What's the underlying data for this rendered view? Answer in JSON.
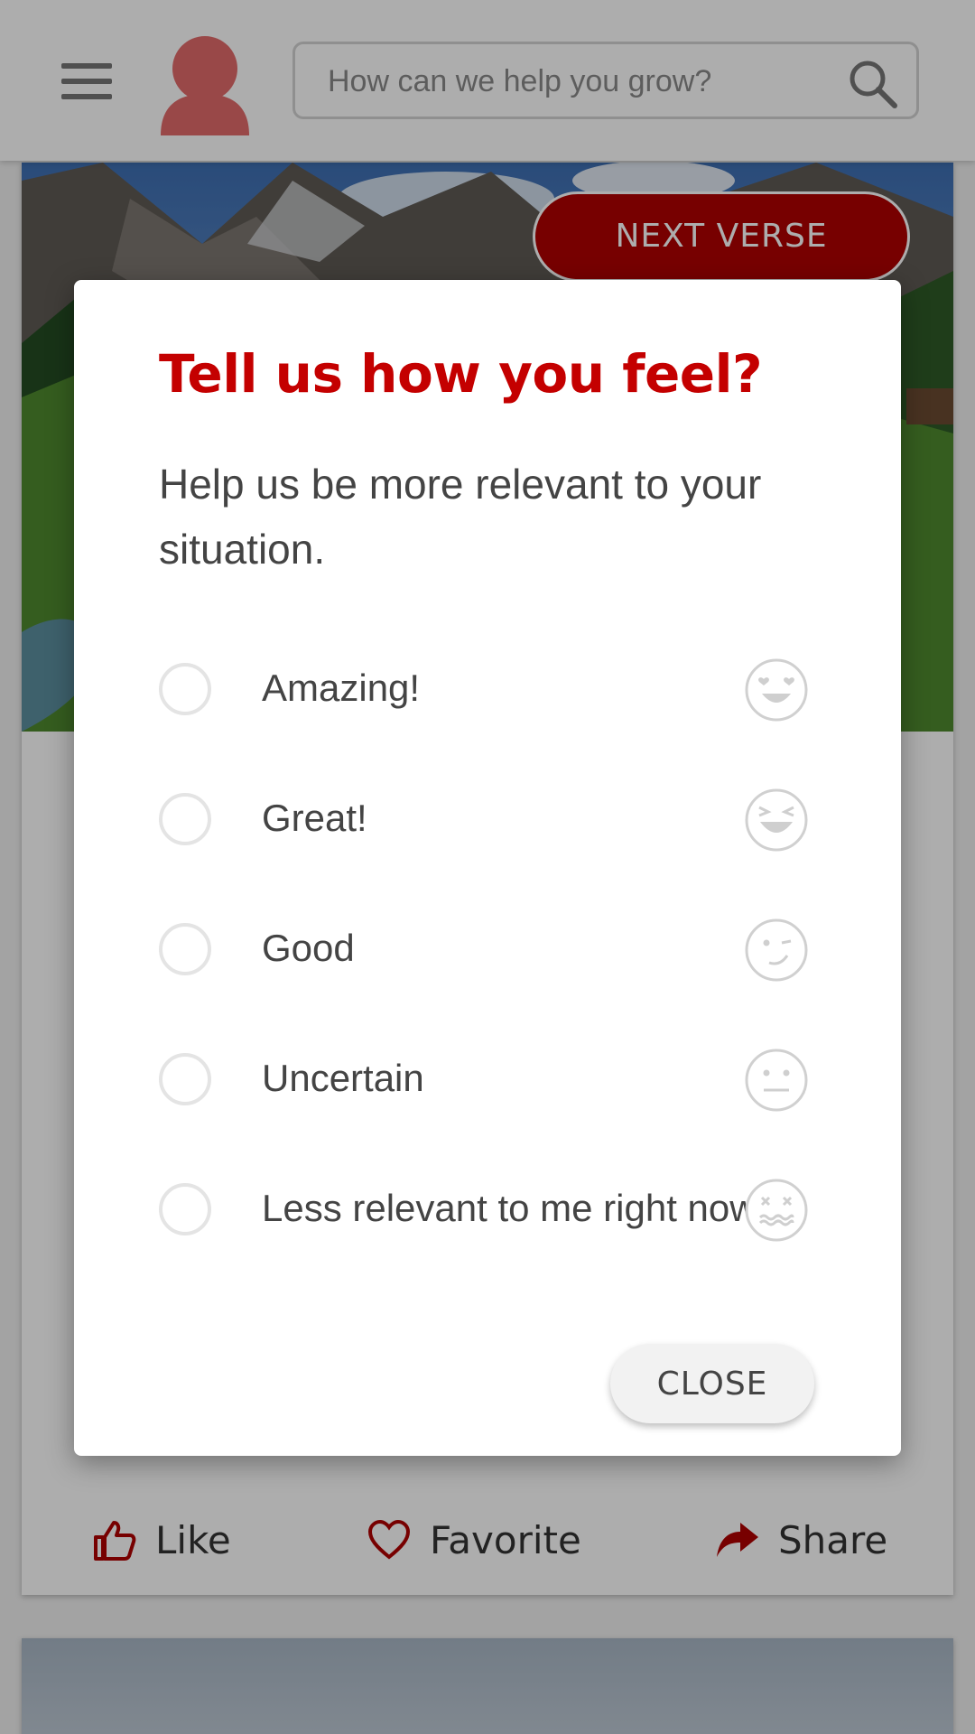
{
  "header": {
    "search_placeholder": "How can we help you grow?"
  },
  "card": {
    "next_verse_label": "NEXT VERSE",
    "actions": [
      {
        "label": "Like",
        "icon": "thumbs-up-icon"
      },
      {
        "label": "Favorite",
        "icon": "heart-icon"
      },
      {
        "label": "Share",
        "icon": "share-arrow-icon"
      }
    ]
  },
  "modal": {
    "title": "Tell us how you feel?",
    "subtitle": "Help us be more relevant to your situation.",
    "options": [
      {
        "label": "Amazing!",
        "icon": "heart-eyes-emoji-icon",
        "selected": false
      },
      {
        "label": "Great!",
        "icon": "grinning-squint-emoji-icon",
        "selected": false
      },
      {
        "label": "Good",
        "icon": "wink-emoji-icon",
        "selected": false
      },
      {
        "label": "Uncertain",
        "icon": "neutral-face-emoji-icon",
        "selected": false
      },
      {
        "label": "Less relevant to me right now",
        "icon": "dizzy-face-emoji-icon",
        "selected": false
      }
    ],
    "close_label": "CLOSE"
  },
  "colors": {
    "accent": "#c40000",
    "button_red": "#b00000",
    "avatar": "#e26a6a"
  }
}
